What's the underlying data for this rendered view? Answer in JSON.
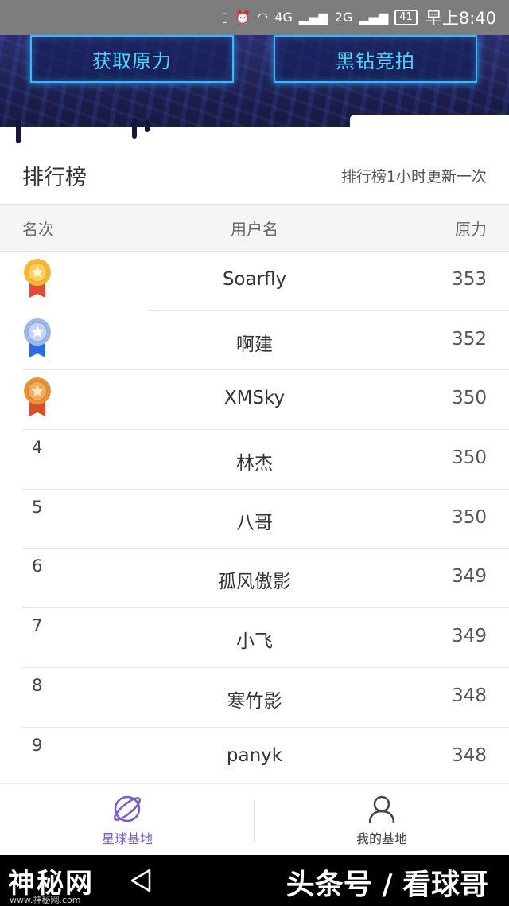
{
  "status_bar": {
    "battery": "41",
    "time": "早上8:40",
    "network_1": "4G",
    "network_2": "2G"
  },
  "banner": {
    "left_button": "获取原力",
    "right_button": "黑钻竞拍"
  },
  "ranking": {
    "title": "排行榜",
    "note": "排行榜1小时更新一次",
    "columns": {
      "rank": "名次",
      "username": "用户名",
      "force": "原力"
    },
    "rows": [
      {
        "rank": "1",
        "medal": "gold",
        "name": "Soarfly",
        "score": "353"
      },
      {
        "rank": "2",
        "medal": "silver",
        "name": "啊建",
        "score": "352"
      },
      {
        "rank": "3",
        "medal": "bronze",
        "name": "XMSky",
        "score": "350"
      },
      {
        "rank": "4",
        "name": "林杰",
        "score": "350"
      },
      {
        "rank": "5",
        "name": "八哥",
        "score": "350"
      },
      {
        "rank": "6",
        "name": "孤风傲影",
        "score": "349"
      },
      {
        "rank": "7",
        "name": "小飞",
        "score": "349"
      },
      {
        "rank": "8",
        "name": "寒竹影",
        "score": "348"
      },
      {
        "rank": "9",
        "name": "panyk",
        "score": "348"
      }
    ]
  },
  "bottom_nav": {
    "left_label": "星球基地",
    "right_label": "我的基地"
  },
  "watermark": {
    "left": "神秘网",
    "left_sub": "www.神秘网.com",
    "right": "头条号 / 看球哥"
  },
  "colors": {
    "accent": "#7a5bc8",
    "banner_glow": "#3fb6ff",
    "banner_bg": "#1a1d4a",
    "gold": "#f5b83a",
    "silver": "#9fb6e8",
    "bronze": "#e8923a"
  }
}
